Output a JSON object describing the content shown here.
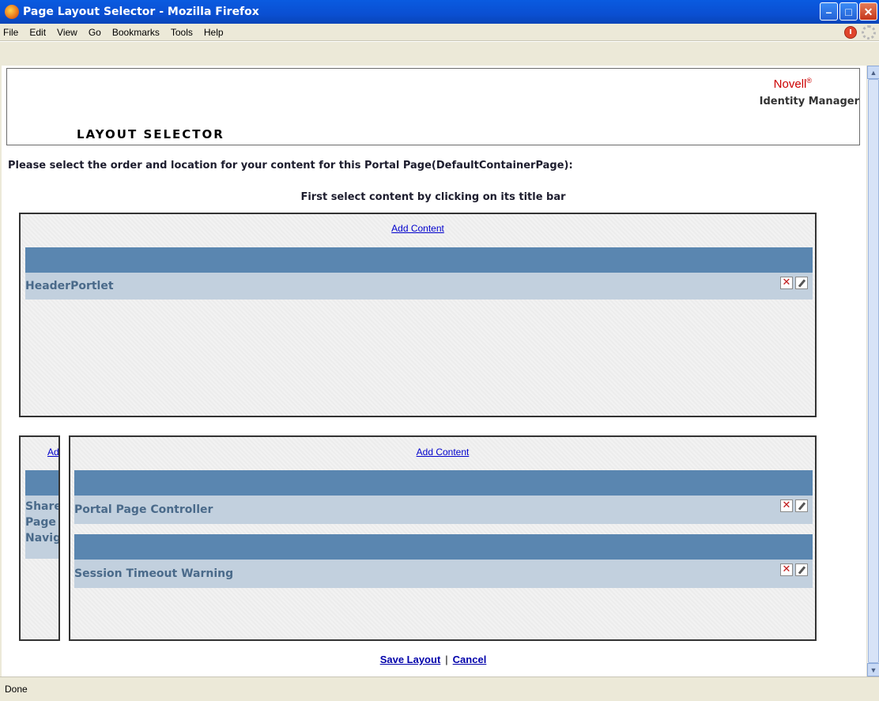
{
  "window": {
    "title": "Page Layout Selector - Mozilla Firefox"
  },
  "menu": {
    "items": [
      "File",
      "Edit",
      "View",
      "Go",
      "Bookmarks",
      "Tools",
      "Help"
    ]
  },
  "header": {
    "brand": "Novell",
    "brand_mark": "®",
    "product": "Identity Manager",
    "section_title": "LAYOUT SELECTOR"
  },
  "instructions": {
    "main": "Please select the order and location for your content for this Portal Page(DefaultContainerPage):",
    "sub": "First select content by clicking on its title bar"
  },
  "top_panel": {
    "add_label": "Add Content",
    "portlets": [
      "HeaderPortlet"
    ]
  },
  "left_panel": {
    "add_label": "Ad",
    "portlet_lines": [
      "Share",
      "Page",
      "Navig"
    ]
  },
  "right_panel": {
    "add_label": "Add Content",
    "portlets": [
      "Portal Page Controller",
      "Session Timeout Warning"
    ]
  },
  "footer": {
    "save_label": "Save Layout",
    "separator": "|",
    "cancel_label": "Cancel"
  },
  "status": {
    "text": "Done"
  },
  "colors": {
    "portlet_bar": "#5a86b0",
    "portlet_row": "#c2d0de",
    "link": "#0000cc",
    "brand": "#cc0000"
  }
}
